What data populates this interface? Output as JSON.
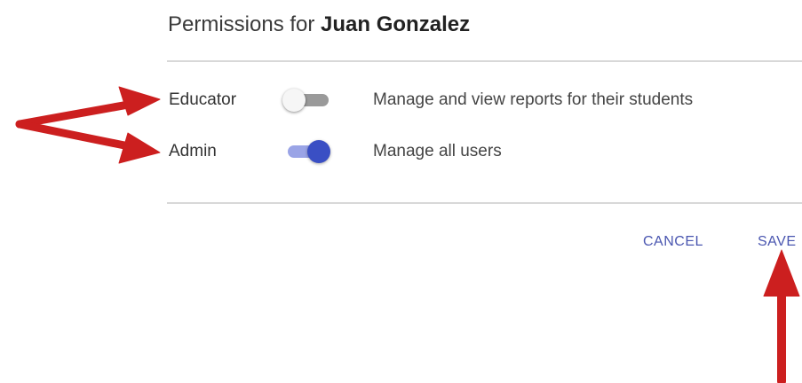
{
  "dialog": {
    "title_prefix": "Permissions for",
    "user_name": "Juan Gonzalez"
  },
  "permissions": [
    {
      "label": "Educator",
      "description": "Manage and view reports for their students",
      "enabled": false
    },
    {
      "label": "Admin",
      "description": "Manage all users",
      "enabled": true
    }
  ],
  "actions": {
    "cancel_label": "CANCEL",
    "save_label": "SAVE"
  },
  "colors": {
    "accent": "#3a4fc4",
    "annotation_arrow": "#cc1f1f"
  }
}
